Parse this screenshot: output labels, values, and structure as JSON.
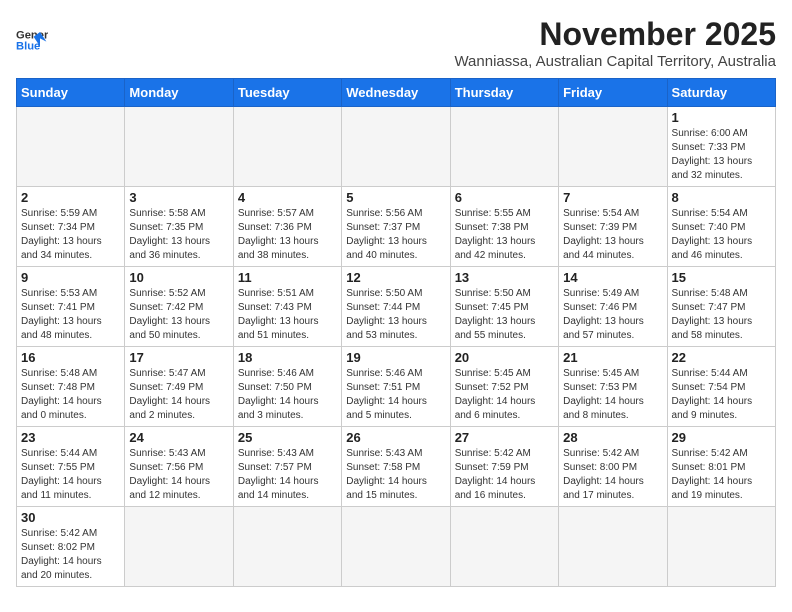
{
  "header": {
    "logo_general": "General",
    "logo_blue": "Blue",
    "month_title": "November 2025",
    "location": "Wanniassa, Australian Capital Territory, Australia"
  },
  "days_of_week": [
    "Sunday",
    "Monday",
    "Tuesday",
    "Wednesday",
    "Thursday",
    "Friday",
    "Saturday"
  ],
  "weeks": [
    [
      {
        "day": "",
        "info": ""
      },
      {
        "day": "",
        "info": ""
      },
      {
        "day": "",
        "info": ""
      },
      {
        "day": "",
        "info": ""
      },
      {
        "day": "",
        "info": ""
      },
      {
        "day": "",
        "info": ""
      },
      {
        "day": "1",
        "info": "Sunrise: 6:00 AM\nSunset: 7:33 PM\nDaylight: 13 hours and 32 minutes."
      }
    ],
    [
      {
        "day": "2",
        "info": "Sunrise: 5:59 AM\nSunset: 7:34 PM\nDaylight: 13 hours and 34 minutes."
      },
      {
        "day": "3",
        "info": "Sunrise: 5:58 AM\nSunset: 7:35 PM\nDaylight: 13 hours and 36 minutes."
      },
      {
        "day": "4",
        "info": "Sunrise: 5:57 AM\nSunset: 7:36 PM\nDaylight: 13 hours and 38 minutes."
      },
      {
        "day": "5",
        "info": "Sunrise: 5:56 AM\nSunset: 7:37 PM\nDaylight: 13 hours and 40 minutes."
      },
      {
        "day": "6",
        "info": "Sunrise: 5:55 AM\nSunset: 7:38 PM\nDaylight: 13 hours and 42 minutes."
      },
      {
        "day": "7",
        "info": "Sunrise: 5:54 AM\nSunset: 7:39 PM\nDaylight: 13 hours and 44 minutes."
      },
      {
        "day": "8",
        "info": "Sunrise: 5:54 AM\nSunset: 7:40 PM\nDaylight: 13 hours and 46 minutes."
      }
    ],
    [
      {
        "day": "9",
        "info": "Sunrise: 5:53 AM\nSunset: 7:41 PM\nDaylight: 13 hours and 48 minutes."
      },
      {
        "day": "10",
        "info": "Sunrise: 5:52 AM\nSunset: 7:42 PM\nDaylight: 13 hours and 50 minutes."
      },
      {
        "day": "11",
        "info": "Sunrise: 5:51 AM\nSunset: 7:43 PM\nDaylight: 13 hours and 51 minutes."
      },
      {
        "day": "12",
        "info": "Sunrise: 5:50 AM\nSunset: 7:44 PM\nDaylight: 13 hours and 53 minutes."
      },
      {
        "day": "13",
        "info": "Sunrise: 5:50 AM\nSunset: 7:45 PM\nDaylight: 13 hours and 55 minutes."
      },
      {
        "day": "14",
        "info": "Sunrise: 5:49 AM\nSunset: 7:46 PM\nDaylight: 13 hours and 57 minutes."
      },
      {
        "day": "15",
        "info": "Sunrise: 5:48 AM\nSunset: 7:47 PM\nDaylight: 13 hours and 58 minutes."
      }
    ],
    [
      {
        "day": "16",
        "info": "Sunrise: 5:48 AM\nSunset: 7:48 PM\nDaylight: 14 hours and 0 minutes."
      },
      {
        "day": "17",
        "info": "Sunrise: 5:47 AM\nSunset: 7:49 PM\nDaylight: 14 hours and 2 minutes."
      },
      {
        "day": "18",
        "info": "Sunrise: 5:46 AM\nSunset: 7:50 PM\nDaylight: 14 hours and 3 minutes."
      },
      {
        "day": "19",
        "info": "Sunrise: 5:46 AM\nSunset: 7:51 PM\nDaylight: 14 hours and 5 minutes."
      },
      {
        "day": "20",
        "info": "Sunrise: 5:45 AM\nSunset: 7:52 PM\nDaylight: 14 hours and 6 minutes."
      },
      {
        "day": "21",
        "info": "Sunrise: 5:45 AM\nSunset: 7:53 PM\nDaylight: 14 hours and 8 minutes."
      },
      {
        "day": "22",
        "info": "Sunrise: 5:44 AM\nSunset: 7:54 PM\nDaylight: 14 hours and 9 minutes."
      }
    ],
    [
      {
        "day": "23",
        "info": "Sunrise: 5:44 AM\nSunset: 7:55 PM\nDaylight: 14 hours and 11 minutes."
      },
      {
        "day": "24",
        "info": "Sunrise: 5:43 AM\nSunset: 7:56 PM\nDaylight: 14 hours and 12 minutes."
      },
      {
        "day": "25",
        "info": "Sunrise: 5:43 AM\nSunset: 7:57 PM\nDaylight: 14 hours and 14 minutes."
      },
      {
        "day": "26",
        "info": "Sunrise: 5:43 AM\nSunset: 7:58 PM\nDaylight: 14 hours and 15 minutes."
      },
      {
        "day": "27",
        "info": "Sunrise: 5:42 AM\nSunset: 7:59 PM\nDaylight: 14 hours and 16 minutes."
      },
      {
        "day": "28",
        "info": "Sunrise: 5:42 AM\nSunset: 8:00 PM\nDaylight: 14 hours and 17 minutes."
      },
      {
        "day": "29",
        "info": "Sunrise: 5:42 AM\nSunset: 8:01 PM\nDaylight: 14 hours and 19 minutes."
      }
    ],
    [
      {
        "day": "30",
        "info": "Sunrise: 5:42 AM\nSunset: 8:02 PM\nDaylight: 14 hours and 20 minutes."
      },
      {
        "day": "",
        "info": ""
      },
      {
        "day": "",
        "info": ""
      },
      {
        "day": "",
        "info": ""
      },
      {
        "day": "",
        "info": ""
      },
      {
        "day": "",
        "info": ""
      },
      {
        "day": "",
        "info": ""
      }
    ]
  ]
}
